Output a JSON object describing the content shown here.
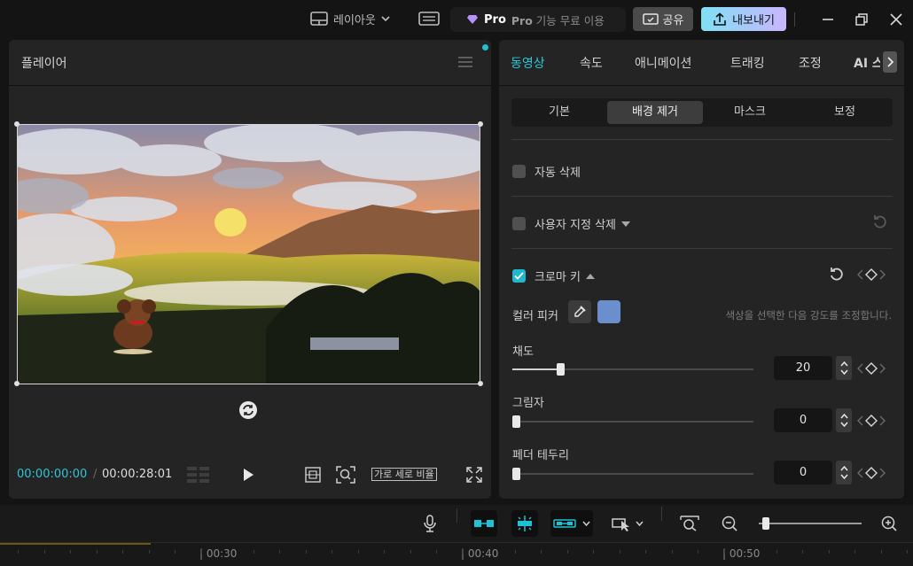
{
  "topbar": {
    "layout_label": "레이아웃",
    "pro_badge": "Pro",
    "pro_text_bold": "Pro",
    "pro_text": " 기능 무료 이용",
    "share_label": "공유",
    "export_label": "내보내기"
  },
  "player": {
    "title": "플레이어",
    "time_current": "00:00:00:00",
    "time_separator": "/",
    "time_total": "00:00:28:01",
    "ratio_label": "가로 세로 비율"
  },
  "right_panel": {
    "tabs": [
      "동영상",
      "속도",
      "애니메이션",
      "트래킹",
      "조정",
      "AI 스"
    ],
    "active_tab": 0,
    "subtabs": [
      "기본",
      "배경 제거",
      "마스크",
      "보정"
    ],
    "active_subtab": 1,
    "auto_remove_label": "자동 삭제",
    "auto_remove_checked": false,
    "custom_remove_label": "사용자 지정 삭제",
    "custom_remove_checked": false,
    "chroma_label": "크로마 키",
    "chroma_checked": true,
    "color_picker_label": "컬러 피커",
    "picked_color": "#6a8fcc",
    "hint": "색상을 선택한 다음 강도를 조정합니다.",
    "sliders": [
      {
        "label": "채도",
        "value": "20",
        "fraction": 0.2
      },
      {
        "label": "그림자",
        "value": "0",
        "fraction": 0
      },
      {
        "label": "페더 테두리",
        "value": "0",
        "fraction": 0
      }
    ]
  },
  "timeline": {
    "ruler_labels": [
      "00:30",
      "00:40",
      "00:50"
    ]
  },
  "colors": {
    "accent": "#2ec6d6",
    "panel": "#242424",
    "background": "#141414"
  }
}
